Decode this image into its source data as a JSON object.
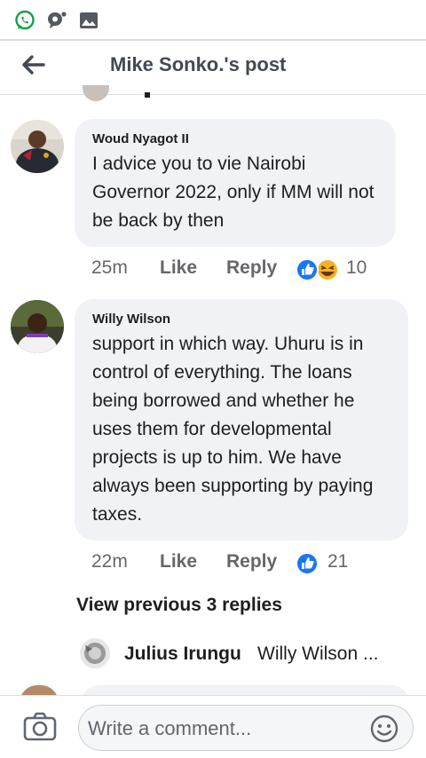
{
  "status_bar": {
    "icons": [
      "whatsapp-icon",
      "chat-bubble-notification-icon",
      "gallery-icon"
    ]
  },
  "header": {
    "title": "Mike Sonko.'s post",
    "back_icon": "arrow-left-icon"
  },
  "colors": {
    "bubble_bg": "#f0f2f5",
    "like_blue": "#1877f2",
    "haha_yellow": "#f7b125",
    "meta_gray": "#65676b"
  },
  "comments": [
    {
      "author": "Woud Nyagot II",
      "text": "I advice you to vie Nairobi Governor 2022, only if MM will not be back by then",
      "time": "25m",
      "like_label": "Like",
      "reply_label": "Reply",
      "reactions": [
        "like-reaction-icon",
        "haha-reaction-icon"
      ],
      "reaction_count": "10"
    },
    {
      "author": "Willy Wilson",
      "text": "support in which way. Uhuru is in control of everything. The loans being borrowed and whether he uses them for developmental projects is up to him. We have always been supporting by paying taxes.",
      "time": "22m",
      "like_label": "Like",
      "reply_label": "Reply",
      "reactions": [
        "like-reaction-icon"
      ],
      "reaction_count": "21"
    }
  ],
  "replies_section": {
    "view_previous": "View previous 3 replies",
    "preview_author": "Julius Irungu",
    "preview_text": "Willy Wilson ..."
  },
  "footer": {
    "camera_icon": "camera-icon",
    "input_placeholder": "Write a comment...",
    "emoji_icon": "smiley-icon"
  }
}
